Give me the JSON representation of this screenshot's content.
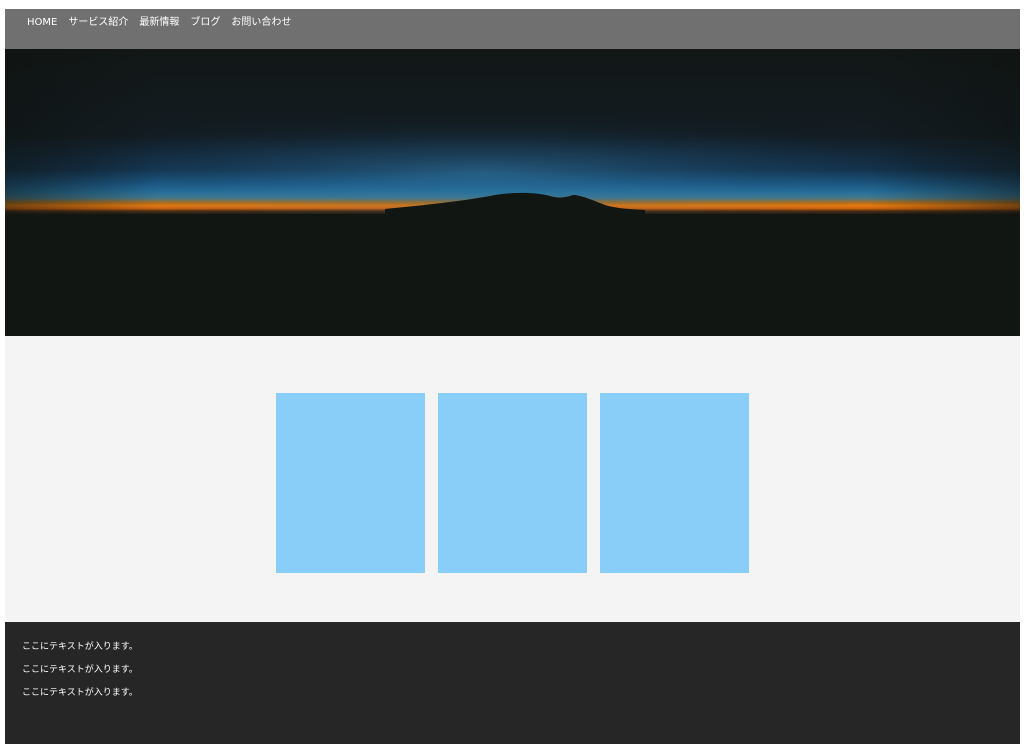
{
  "nav": {
    "items": [
      {
        "label": "HOME"
      },
      {
        "label": "サービス紹介"
      },
      {
        "label": "最新情報"
      },
      {
        "label": "ブログ"
      },
      {
        "label": "お問い合わせ"
      }
    ]
  },
  "hero": {
    "image": "sunset-horizon-mountain-silhouette"
  },
  "tiles": {
    "color": "#89cef9",
    "count": 3
  },
  "footer": {
    "lines": [
      {
        "text": "ここにテキストが入ります。"
      },
      {
        "text": "ここにテキストが入ります。"
      },
      {
        "text": "ここにテキストが入ります。"
      }
    ]
  },
  "colors": {
    "navbar": "#707070",
    "content_bg": "#f4f4f4",
    "footer_bg": "#262626"
  }
}
